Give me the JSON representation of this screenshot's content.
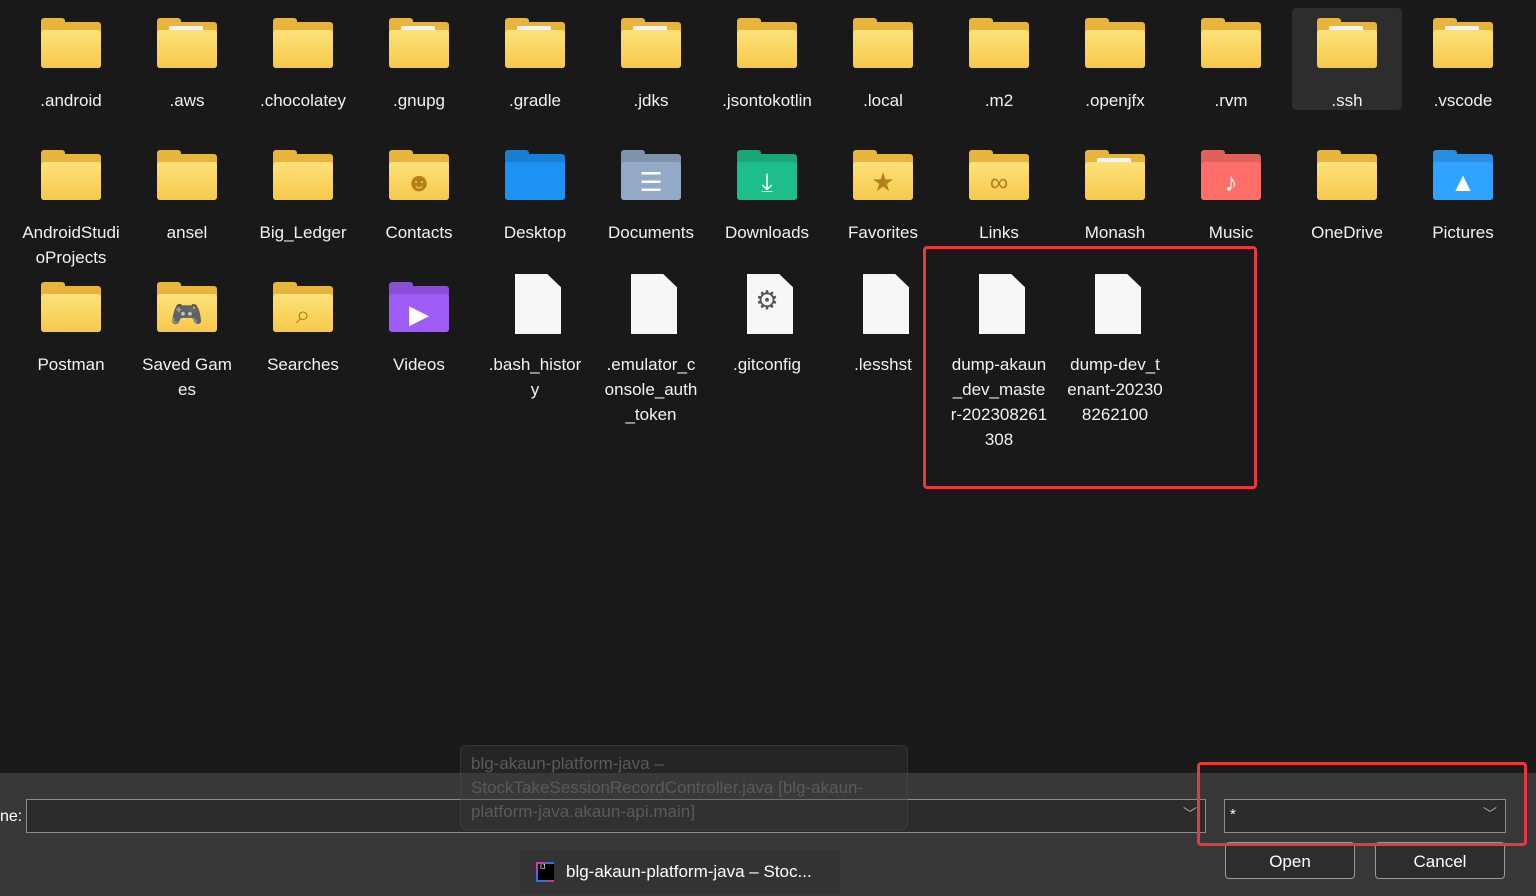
{
  "items": [
    {
      "label": ".android",
      "type": "folder",
      "glyph": ""
    },
    {
      "label": ".aws",
      "type": "folder-doc",
      "glyph": ""
    },
    {
      "label": ".chocolatey",
      "type": "folder",
      "glyph": ""
    },
    {
      "label": ".gnupg",
      "type": "folder-doc",
      "glyph": ""
    },
    {
      "label": ".gradle",
      "type": "folder-doc",
      "glyph": ""
    },
    {
      "label": ".jdks",
      "type": "folder-doc",
      "glyph": ""
    },
    {
      "label": ".jsontokotlin",
      "type": "folder",
      "glyph": ""
    },
    {
      "label": ".local",
      "type": "folder",
      "glyph": ""
    },
    {
      "label": ".m2",
      "type": "folder",
      "glyph": ""
    },
    {
      "label": ".openjfx",
      "type": "folder",
      "glyph": ""
    },
    {
      "label": ".rvm",
      "type": "folder",
      "glyph": ""
    },
    {
      "label": ".ssh",
      "type": "folder-doc",
      "glyph": "",
      "selected": true
    },
    {
      "label": ".vscode",
      "type": "folder-doc",
      "glyph": ""
    },
    {
      "label": "AndroidStudioProjects",
      "type": "folder",
      "glyph": ""
    },
    {
      "label": "ansel",
      "type": "folder",
      "glyph": ""
    },
    {
      "label": "Big_Ledger",
      "type": "folder",
      "glyph": ""
    },
    {
      "label": "Contacts",
      "type": "folder",
      "glyph": "☻"
    },
    {
      "label": "Desktop",
      "type": "special",
      "glyph": "",
      "color": "#1a7fd4"
    },
    {
      "label": "Documents",
      "type": "special",
      "glyph": "☰",
      "color": "#7f93ad"
    },
    {
      "label": "Downloads",
      "type": "special",
      "glyph": "⤓",
      "color": "#1aa57a"
    },
    {
      "label": "Favorites",
      "type": "folder",
      "glyph": "★"
    },
    {
      "label": "Links",
      "type": "folder",
      "glyph": "∞"
    },
    {
      "label": "Monash",
      "type": "folder-doc",
      "glyph": ""
    },
    {
      "label": "Music",
      "type": "special",
      "glyph": "♪",
      "color": "#e0605a"
    },
    {
      "label": "OneDrive",
      "type": "folder",
      "glyph": ""
    },
    {
      "label": "Pictures",
      "type": "special",
      "glyph": "▲",
      "color": "#2a8de0"
    },
    {
      "label": "Postman",
      "type": "folder",
      "glyph": ""
    },
    {
      "label": "Saved Games",
      "type": "folder",
      "glyph": "🎮"
    },
    {
      "label": "Searches",
      "type": "folder",
      "glyph": "⌕"
    },
    {
      "label": "Videos",
      "type": "special",
      "glyph": "▶",
      "color": "#8a4fd6"
    },
    {
      "label": ".bash_history",
      "type": "file",
      "glyph": ""
    },
    {
      "label": ".emulator_console_auth_token",
      "type": "file",
      "glyph": ""
    },
    {
      "label": ".gitconfig",
      "type": "file",
      "glyph": "⚙"
    },
    {
      "label": ".lesshst",
      "type": "file",
      "glyph": ""
    },
    {
      "label": "dump-akaun_dev_master-202308261308",
      "type": "file",
      "glyph": ""
    },
    {
      "label": "dump-dev_tenant-202308262100",
      "type": "file",
      "glyph": ""
    }
  ],
  "footer": {
    "filename_label": "ne:",
    "filename_value": "",
    "filter_value": "*",
    "open_label": "Open",
    "cancel_label": "Cancel"
  },
  "tooltip": "blg-akaun-platform-java – StockTakeSessionRecordController.java [blg-akaun-platform-java.akaun-api.main]",
  "taskbar_item": "blg-akaun-platform-java – Stoc...",
  "colors": {
    "highlight": "#e8393c",
    "folder": "#f6c94b"
  }
}
